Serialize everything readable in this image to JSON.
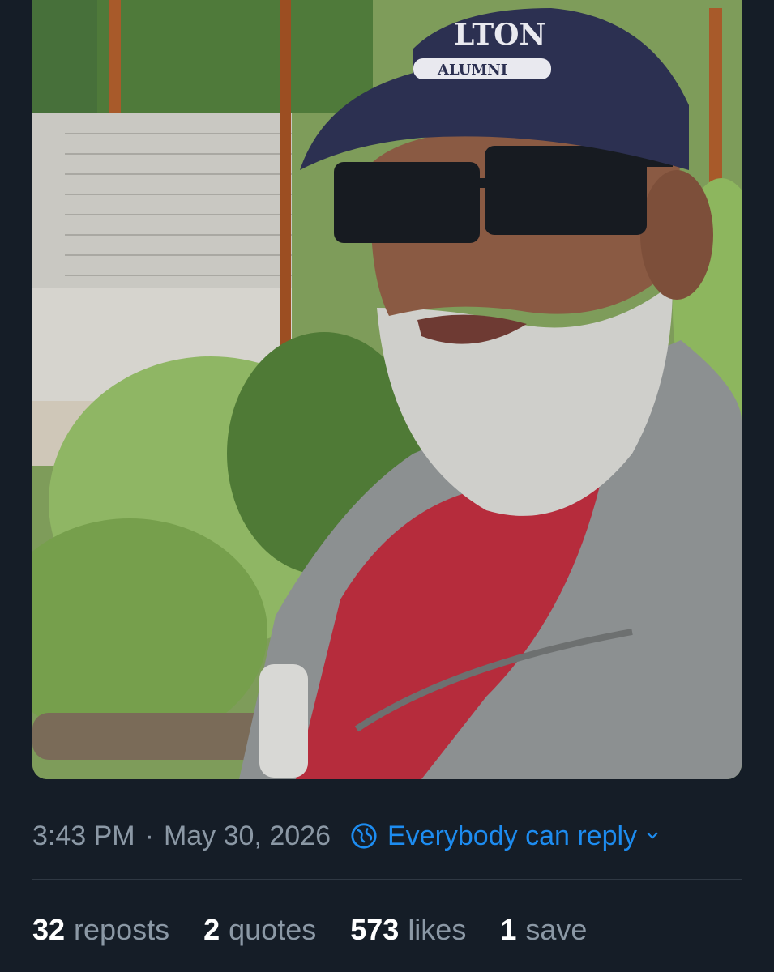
{
  "post": {
    "timestamp": "3:43 PM",
    "separator": "·",
    "date": "May 30, 2026",
    "reply_setting": "Everybody can reply",
    "photo": {
      "alt": "Selfie photo of a man with a gray beard wearing sunglasses, navy cap and gray zip jacket over a red shirt, standing above outdoor stairs and greenery",
      "cap_text": "LTON",
      "cap_subtext": "ALUMNI"
    }
  },
  "stats": {
    "reposts": {
      "count": "32",
      "label": "reposts"
    },
    "quotes": {
      "count": "2",
      "label": "quotes"
    },
    "likes": {
      "count": "573",
      "label": "likes"
    },
    "saves": {
      "count": "1",
      "label": "save"
    }
  },
  "colors": {
    "background": "#151d27",
    "accent": "#1d8cf0",
    "muted": "#8b98a5",
    "divider": "#2f3843"
  },
  "icons": {
    "reply_setting": "globe-icon",
    "dropdown": "chevron-down-icon"
  }
}
